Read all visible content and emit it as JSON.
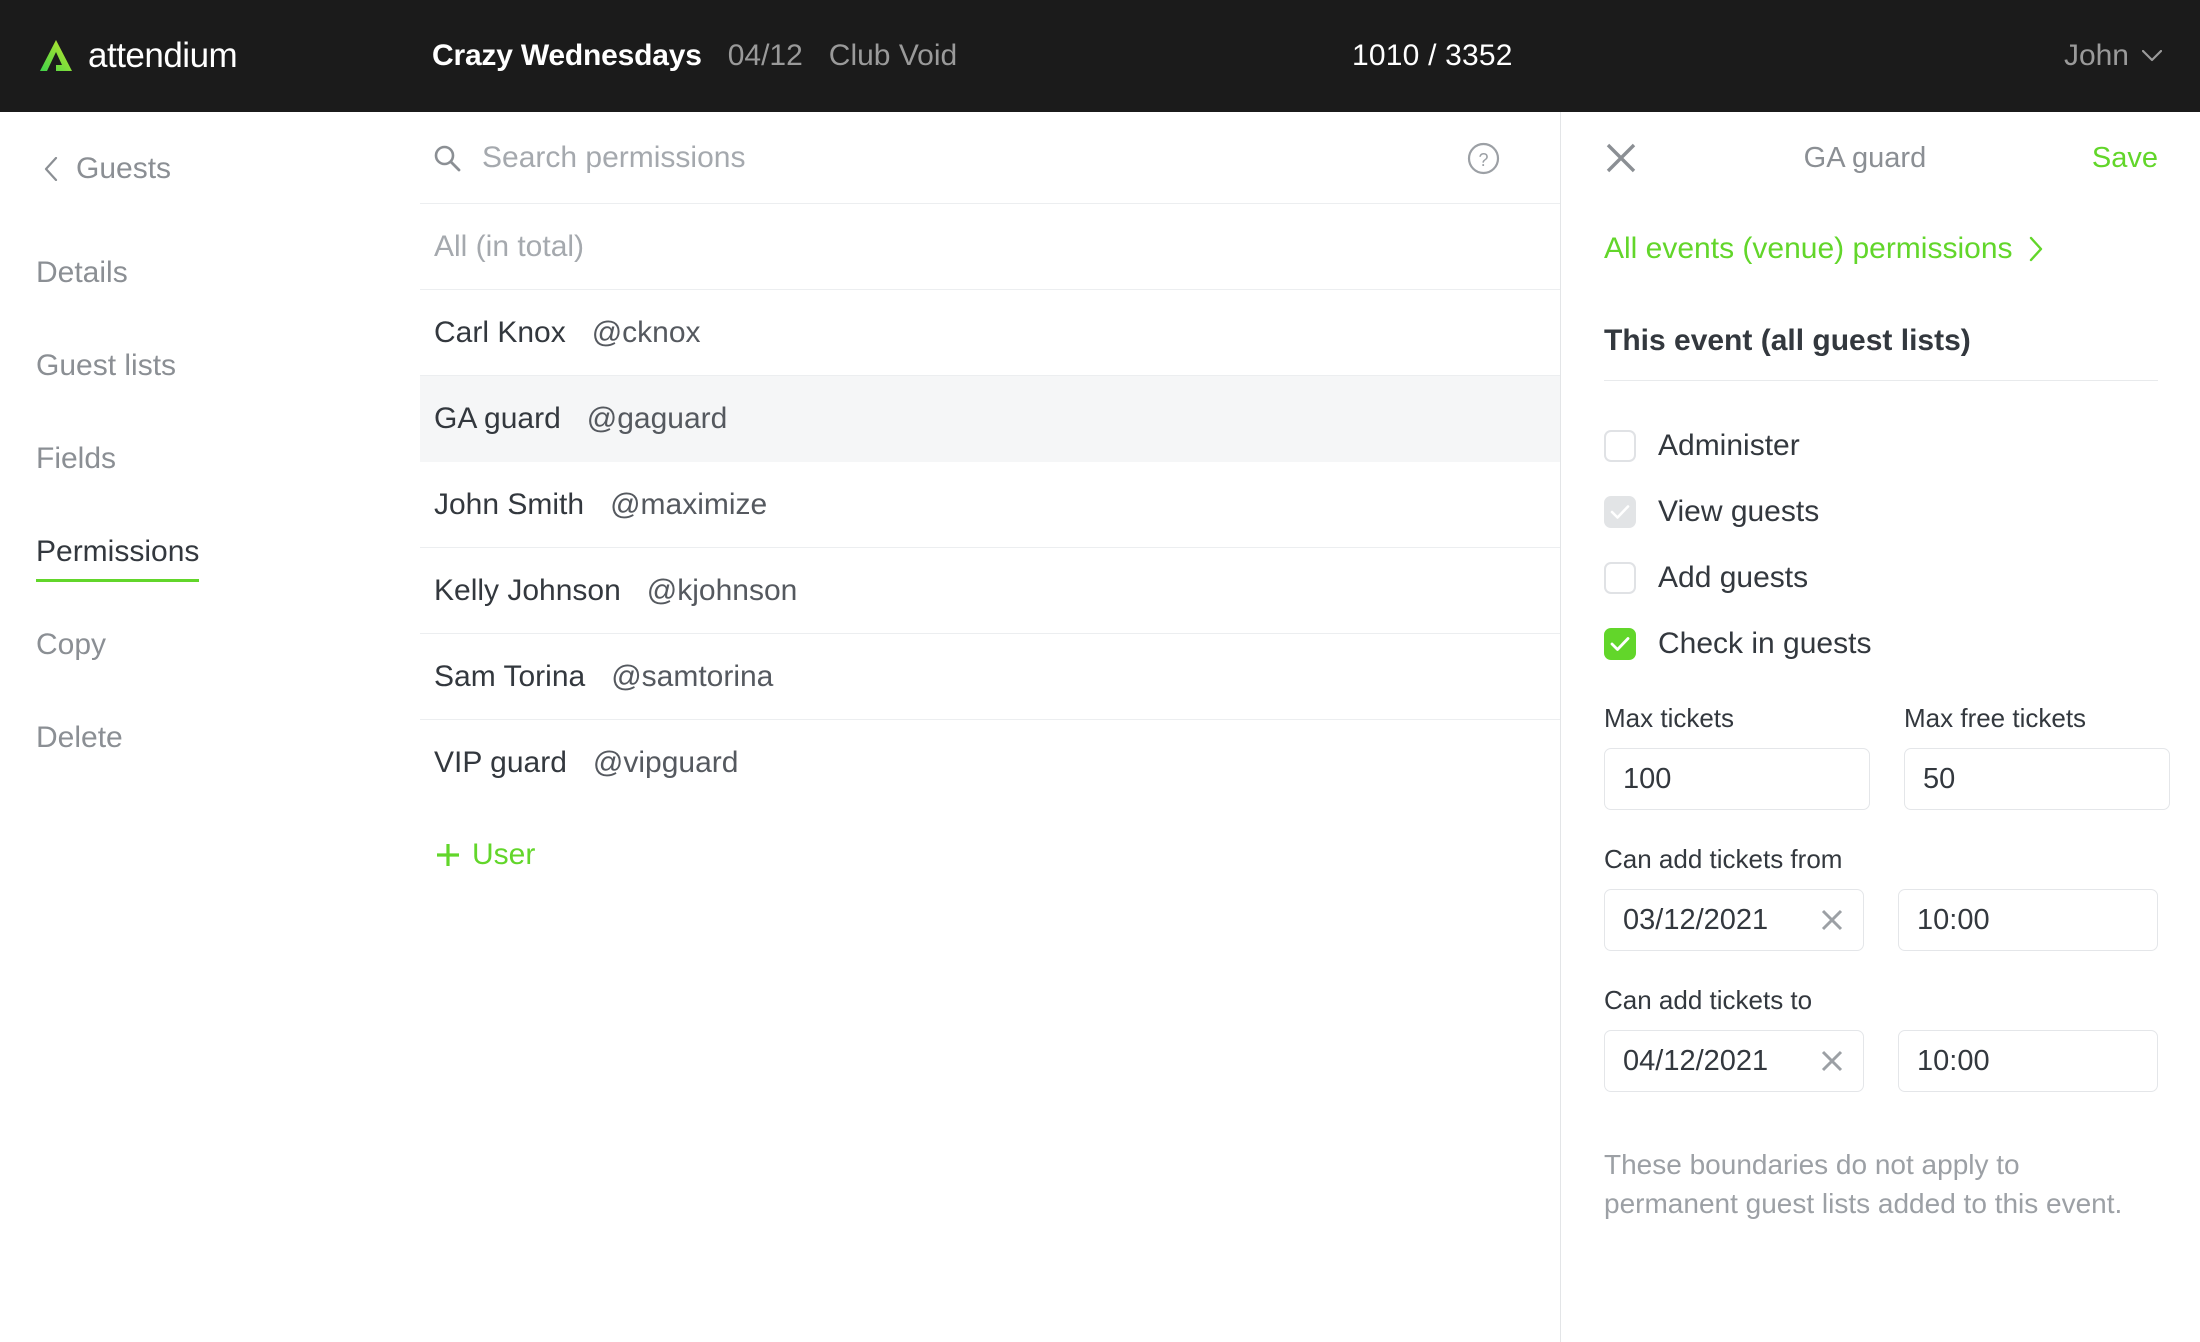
{
  "brand": {
    "name": "attendium",
    "logo_icon": "triangle-logo-icon",
    "accent_green": "#62d62a",
    "topbar_bg": "#1b1b1b"
  },
  "topbar": {
    "event_name": "Crazy Wednesdays",
    "event_date": "04/12",
    "event_venue": "Club Void",
    "counter": "1010 / 3352",
    "user_name": "John",
    "user_chevron_icon": "chevron-down-icon"
  },
  "sidebar": {
    "back_label": "Guests",
    "back_icon": "chevron-left-icon",
    "items": [
      {
        "label": "Details",
        "active": false
      },
      {
        "label": "Guest lists",
        "active": false
      },
      {
        "label": "Fields",
        "active": false
      },
      {
        "label": "Permissions",
        "active": true
      },
      {
        "label": "Copy",
        "active": false
      },
      {
        "label": "Delete",
        "active": false
      }
    ]
  },
  "search": {
    "icon": "search-icon",
    "placeholder": "Search permissions",
    "value": "",
    "help_icon": "question-circle-icon"
  },
  "permissions_list": {
    "header": "All (in total)",
    "rows": [
      {
        "name": "Carl Knox",
        "handle": "@cknox",
        "selected": false
      },
      {
        "name": "GA guard",
        "handle": "@gaguard",
        "selected": true
      },
      {
        "name": "John Smith",
        "handle": "@maximize",
        "selected": false
      },
      {
        "name": "Kelly Johnson",
        "handle": "@kjohnson",
        "selected": false
      },
      {
        "name": "Sam Torina",
        "handle": "@samtorina",
        "selected": false
      },
      {
        "name": "VIP guard",
        "handle": "@vipguard",
        "selected": false
      }
    ],
    "add_user_label": "User",
    "add_user_icon": "plus-icon"
  },
  "panel": {
    "close_icon": "close-icon",
    "title": "GA guard",
    "save_label": "Save",
    "venue_link_label": "All events (venue) permissions",
    "venue_link_icon": "chevron-right-icon",
    "section_title": "This event (all guest lists)",
    "checkboxes": [
      {
        "label": "Administer",
        "state": "off"
      },
      {
        "label": "View guests",
        "state": "disabled-on"
      },
      {
        "label": "Add guests",
        "state": "off"
      },
      {
        "label": "Check in guests",
        "state": "on"
      }
    ],
    "max_tickets_label": "Max tickets",
    "max_tickets_value": "100",
    "max_free_tickets_label": "Max free tickets",
    "max_free_tickets_value": "50",
    "from_label": "Can add tickets from",
    "from_date": "03/12/2021",
    "from_time": "10:00",
    "to_label": "Can add tickets to",
    "to_date": "04/12/2021",
    "to_time": "10:00",
    "clear_icon": "close-x-icon",
    "note": "These boundaries do not apply to permanent guest lists added to this event."
  }
}
